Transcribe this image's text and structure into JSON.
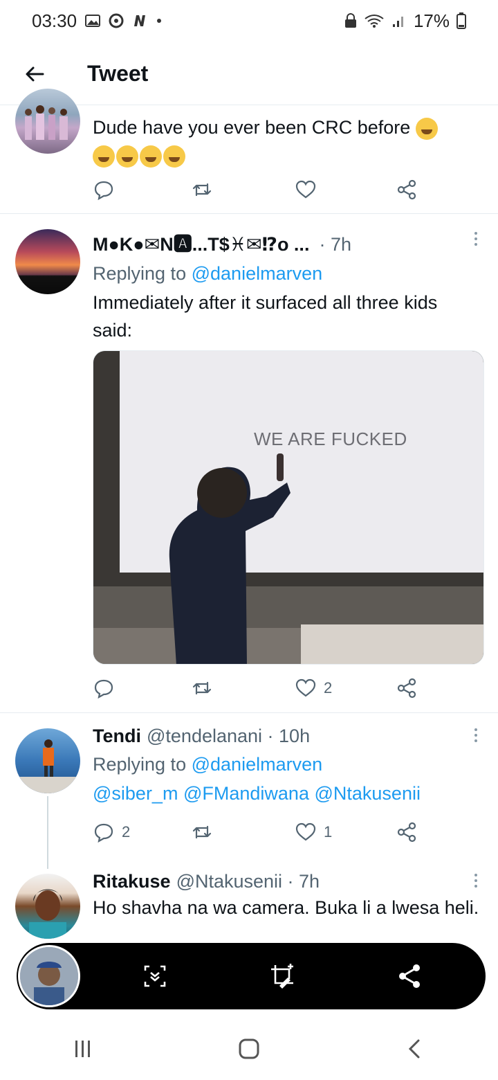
{
  "status": {
    "time": "03:30",
    "battery": "17%"
  },
  "header": {
    "title": "Tweet"
  },
  "tweets": [
    {
      "text": "Dude have you ever been CRC before",
      "actions": {
        "reply": "",
        "retweet": "",
        "like": ""
      }
    },
    {
      "name": "M●K●✉N🅰...T$♓✉⁉o ...",
      "time": "· 7h",
      "replying_label": "Replying to",
      "replying_to": "@danielmarven",
      "text": "Immediately after it surfaced all three kids said:",
      "media_caption": "WE ARE FUCKED",
      "actions": {
        "reply": "",
        "retweet": "",
        "like": "2"
      }
    },
    {
      "name": "Tendi",
      "handle": "@tendelanani · 10h",
      "replying_label": "Replying to",
      "replying_to": "@danielmarven",
      "mentions": [
        "@siber_m",
        "@FMandiwana",
        "@Ntakusenii"
      ],
      "actions": {
        "reply": "2",
        "retweet": "",
        "like": "1"
      }
    },
    {
      "name": "Ritakuse",
      "handle": "@Ntakusenii · 7h",
      "text": "Ho shavha na wa camera. Buka li a lwesa heli."
    }
  ],
  "icons": {
    "back": "arrow-left-icon",
    "reply": "reply-icon",
    "retweet": "retweet-icon",
    "like": "heart-icon",
    "share": "share-icon",
    "scroll_capture": "scroll-capture-icon",
    "crop_edit": "crop-edit-icon",
    "nav_recents": "recents-icon",
    "nav_home": "home-icon",
    "nav_back": "nav-back-icon"
  },
  "colors": {
    "link": "#1d9bf0",
    "secondary": "#536471",
    "divider": "#e6ecf0"
  }
}
